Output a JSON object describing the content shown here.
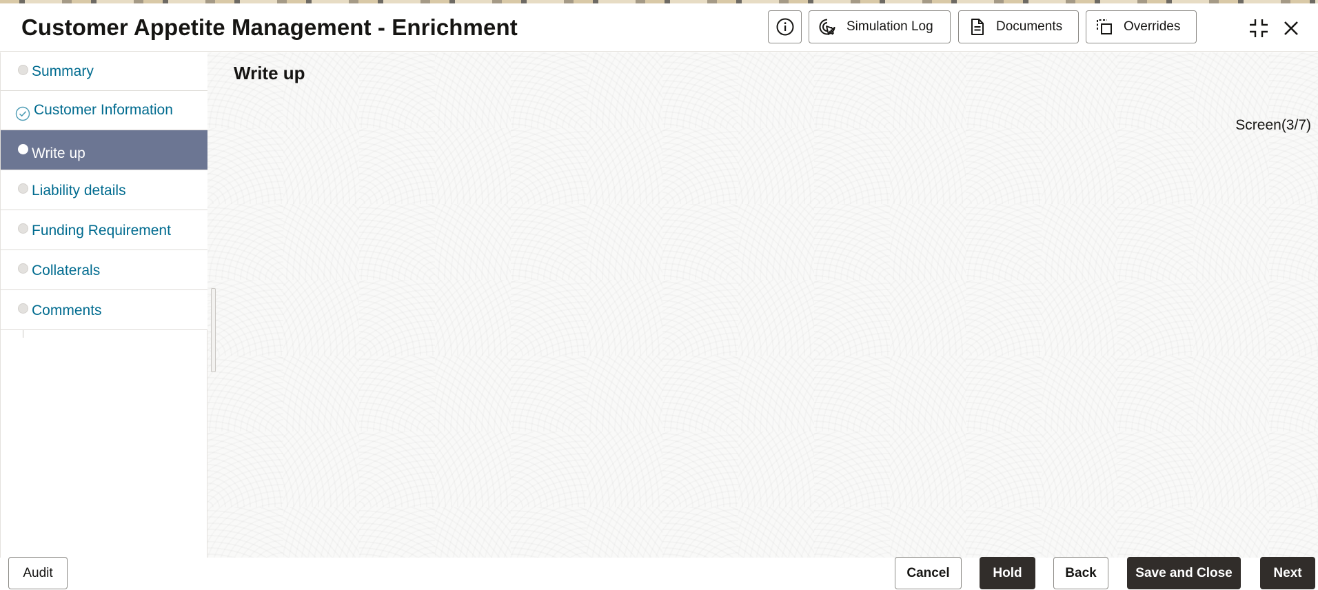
{
  "header": {
    "title": "Customer Appetite Management - Enrichment",
    "info_icon": "info-icon",
    "simulation_log_label": "Simulation Log",
    "documents_label": "Documents",
    "overrides_label": "Overrides"
  },
  "sidebar": {
    "items": [
      {
        "label": "Summary",
        "state": "pending"
      },
      {
        "label": "Customer Information",
        "state": "completed"
      },
      {
        "label": "Write up",
        "state": "active"
      },
      {
        "label": "Liability details",
        "state": "pending"
      },
      {
        "label": "Funding Requirement",
        "state": "pending"
      },
      {
        "label": "Collaterals",
        "state": "pending"
      },
      {
        "label": "Comments",
        "state": "pending"
      }
    ]
  },
  "main": {
    "title": "Write up",
    "screen_counter": "Screen(3/7)"
  },
  "footer": {
    "audit_label": "Audit",
    "cancel_label": "Cancel",
    "hold_label": "Hold",
    "back_label": "Back",
    "save_close_label": "Save and Close",
    "next_label": "Next"
  },
  "colors": {
    "active_nav_bg": "#6c7693",
    "link_text": "#006b8f",
    "dark_button": "#312d2a"
  }
}
